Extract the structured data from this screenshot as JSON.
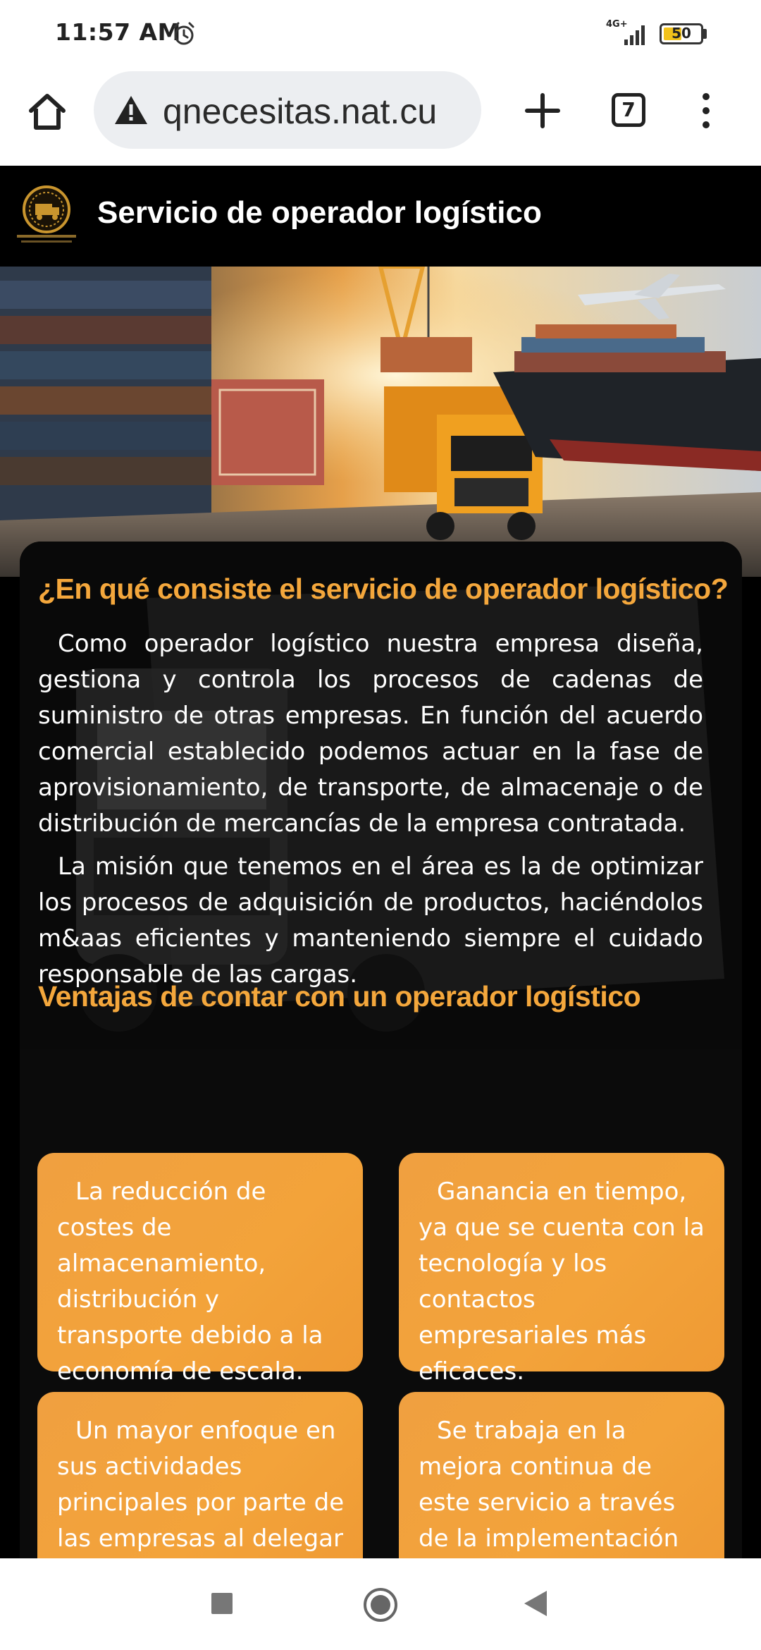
{
  "status_bar": {
    "time": "11:57 AM",
    "network": "4G+",
    "battery": "50",
    "icons": [
      "alarm-icon",
      "signal-icon",
      "battery-icon"
    ]
  },
  "browser": {
    "url": "qnecesitas.nat.cu",
    "tab_count": "7",
    "icons": [
      "home-icon",
      "warning-icon",
      "new-tab-icon",
      "menu-icon"
    ]
  },
  "header": {
    "title": "Servicio de operador logístico"
  },
  "main": {
    "section1": {
      "heading": "¿En qué consiste el servicio de operador logístico?",
      "paragraphs": [
        "Como operador logístico nuestra empresa diseña, gestiona y controla los procesos de cadenas de suministro de otras empresas. En función del acuerdo comercial establecido podemos actuar en la fase de aprovisionamiento, de transporte, de almacenaje o de distribución de mercancías de la empresa contratada.",
        "La misión que tenemos en el área es la de optimizar los procesos de adquisición de productos, haciéndolos m&aas eficientes y manteniendo siempre el cuidado responsable de las cargas."
      ]
    },
    "section2": {
      "heading": "Ventajas de contar con un operador logístico",
      "advantages": [
        "La reducción de costes de almacenamiento, distribución y transporte debido a la economía de escala.",
        "Ganancia en tiempo, ya que se cuenta con la tecnología y los contactos empresariales más eficaces.",
        "Un mayor enfoque en sus actividades principales por parte de las empresas al delegar",
        "Se trabaja en la mejora continua de este servicio a través de la implementación de"
      ]
    }
  },
  "colors": {
    "accent": "#f4a73c",
    "box": "#f3a33a",
    "background": "#000000"
  }
}
